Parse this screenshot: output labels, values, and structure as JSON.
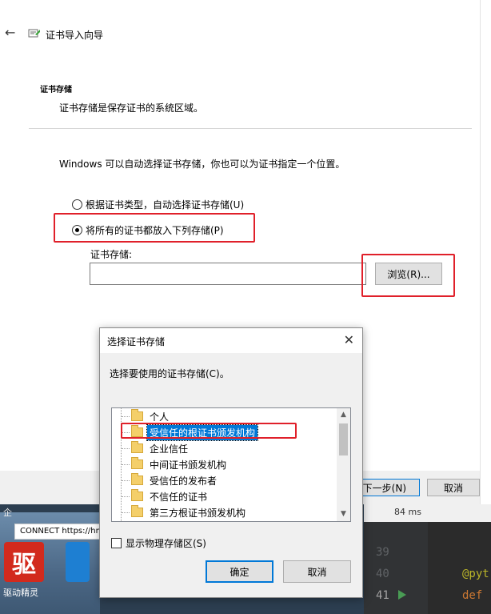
{
  "wizard": {
    "title": "证书导入向导",
    "section_title": "证书存储",
    "section_desc": "证书存储是保存证书的系统区域。",
    "intro": "Windows 可以自动选择证书存储，你也可以为证书指定一个位置。",
    "radio_auto": "根据证书类型，自动选择证书存储(U)",
    "radio_manual": "将所有的证书都放入下列存储(P)",
    "store_label": "证书存储:",
    "store_value": "",
    "browse_label": "浏览(R)...",
    "next_label": "下一步(N)",
    "cancel_label": "取消"
  },
  "dialog": {
    "title": "选择证书存储",
    "prompt": "选择要使用的证书存储(C)。",
    "items": [
      {
        "label": "个人"
      },
      {
        "label": "受信任的根证书颁发机构"
      },
      {
        "label": "企业信任"
      },
      {
        "label": "中间证书颁发机构"
      },
      {
        "label": "受信任的发布者"
      },
      {
        "label": "不信任的证书"
      },
      {
        "label": "第三方根证书颁发机构"
      }
    ],
    "selected_index": 1,
    "show_physical": "显示物理存储区(S)",
    "ok_label": "确定",
    "cancel_label": "取消"
  },
  "desktop": {
    "connect_text": "CONNECT https://hm",
    "edge_label": "企",
    "app_label": "驱动精灵",
    "app_glyph": "驱",
    "timing": "84 ms"
  },
  "editor": {
    "lines": [
      {
        "num": "39",
        "code": ""
      },
      {
        "num": "40",
        "code": "@pyt"
      },
      {
        "num": "41",
        "code": "def"
      }
    ],
    "decorator_color": "#bbb529",
    "keyword_color": "#cc7832"
  },
  "highlight_color": "#e0202a"
}
